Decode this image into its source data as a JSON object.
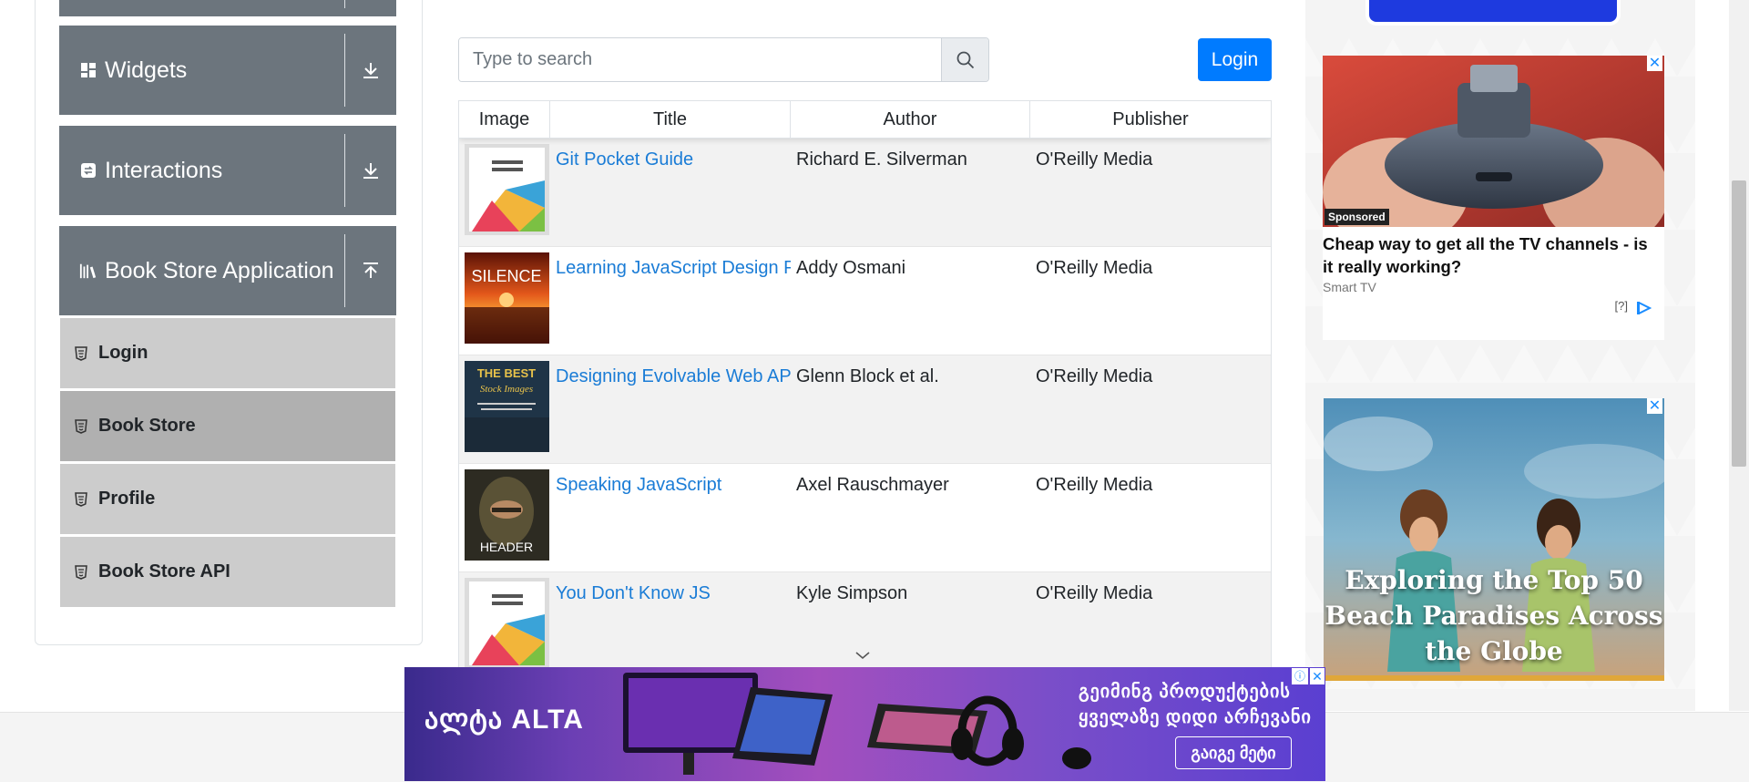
{
  "sidebar": {
    "groups": [
      {
        "label": "Widgets",
        "icon": "widgets-icon",
        "arrow": "expand-down-icon"
      },
      {
        "label": "Interactions",
        "icon": "interactions-icon",
        "arrow": "expand-down-icon"
      },
      {
        "label": "Book Store Application",
        "icon": "books-icon",
        "arrow": "collapse-up-icon"
      }
    ],
    "items": [
      {
        "label": "Login",
        "active": false
      },
      {
        "label": "Book Store",
        "active": true
      },
      {
        "label": "Profile",
        "active": false
      },
      {
        "label": "Book Store API",
        "active": false
      }
    ]
  },
  "search": {
    "placeholder": "Type to search",
    "value": ""
  },
  "login_button": "Login",
  "table": {
    "headers": [
      "Image",
      "Title",
      "Author",
      "Publisher"
    ],
    "rows": [
      {
        "title": "Git Pocket Guide",
        "author": "Richard E. Silverman",
        "publisher": "O'Reilly Media",
        "cover": "Business Design cover"
      },
      {
        "title": "Learning JavaScript Design Patterns",
        "author": "Addy Osmani",
        "publisher": "O'Reilly Media",
        "cover": "Silence cover"
      },
      {
        "title": "Designing Evolvable Web APIs with ASP.NET",
        "author": "Glenn Block et al.",
        "publisher": "O'Reilly Media",
        "cover": "The Best Stock Images cover"
      },
      {
        "title": "Speaking JavaScript",
        "author": "Axel Rauschmayer",
        "publisher": "O'Reilly Media",
        "cover": "Header cover"
      },
      {
        "title": "You Don't Know JS",
        "author": "Kyle Simpson",
        "publisher": "O'Reilly Media",
        "cover": "Business Design cover"
      }
    ]
  },
  "ads": {
    "ad1": {
      "badge": "Sponsored",
      "title": "Cheap way to get all the TV channels - is it really working?",
      "source": "Smart TV",
      "help": "[?]"
    },
    "ad2": {
      "title": "Exploring the Top 50 Beach Paradises Across the Globe"
    },
    "banner": {
      "logo": "ალტა ALTA",
      "line1": "გეიმინგ პროდუქტების",
      "line2": "ყველაზე დიდი არჩევანი",
      "cta": "გაიგე მეტი"
    }
  },
  "colors": {
    "sidebar_group": "#6c757d",
    "sidebar_item": "#cccccc",
    "sidebar_item_active": "#b0b0b0",
    "accent": "#007bff",
    "link": "#1a7cd6"
  }
}
